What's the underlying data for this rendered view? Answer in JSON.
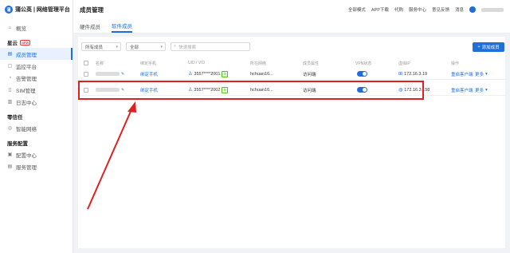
{
  "brand": {
    "logo": "蒲",
    "name": "蒲公英 | 网络管理平台"
  },
  "sidebar": {
    "overview": "概览",
    "group_xingyun": "星云",
    "group_badge": "NEW",
    "items_xingyun": [
      "成员管理",
      "监控平台",
      "告警管理",
      "SIM管理",
      "日志中心"
    ],
    "group_lingxinren": "零信任",
    "items_lingxinren": [
      "智能网络"
    ],
    "group_service": "服务配置",
    "items_service": [
      "配置中心",
      "服务管理"
    ]
  },
  "header": {
    "title": "成员管理",
    "links": [
      "全部模式",
      "APP下载",
      "代购",
      "服务中心",
      "意见反馈",
      "消息"
    ]
  },
  "tabs": [
    "硬件成员",
    "软件成员"
  ],
  "active_tab": 1,
  "filters": {
    "member_type": "所有成员",
    "scope": "全部",
    "search_placeholder": "快速搜索"
  },
  "add_button": "添加成员",
  "table": {
    "headers": [
      "名称",
      "绑定手机",
      "UID / VID",
      "所在网络",
      "成员属性",
      "VPN状态",
      "虚拟IP",
      "操作"
    ],
    "rows": [
      {
        "phone": "绑定手机",
        "uid": "3557****2001",
        "bind": "账",
        "network": "hchuan16...",
        "attr": "访问端",
        "ip": "172.16.3.19",
        "action1": "重启客户端",
        "action2": "更多"
      },
      {
        "phone": "绑定手机",
        "uid": "3557****2002",
        "bind": "账",
        "network": "hchuan16...",
        "attr": "访问端",
        "ip": "172.16.3.158",
        "action1": "重启客户端",
        "action2": "更多"
      }
    ]
  },
  "colors": {
    "accent": "#1e6fd9",
    "highlight": "#e02020"
  }
}
